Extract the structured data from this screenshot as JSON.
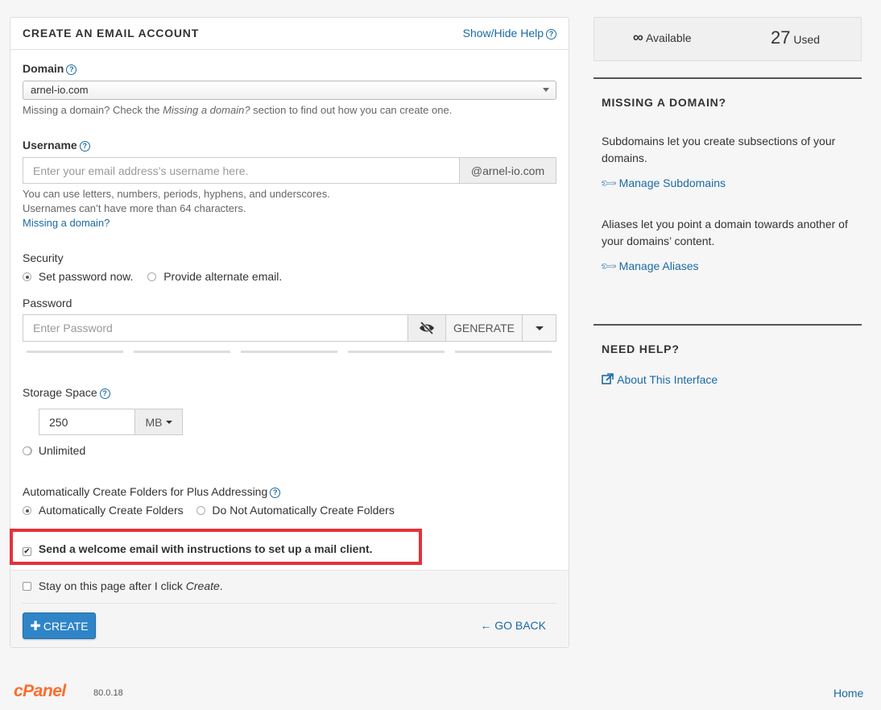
{
  "form": {
    "title": "CREATE AN EMAIL ACCOUNT",
    "help_toggle": "Show/Hide Help",
    "domain_label": "Domain",
    "domain_value": "arnel-io.com",
    "domain_help_prefix": "Missing a domain? Check the ",
    "domain_help_em": "Missing a domain?",
    "domain_help_suffix": " section to find out how you can create one.",
    "username_label": "Username",
    "username_placeholder": "Enter your email address’s username here.",
    "username_suffix": "@arnel-io.com",
    "username_help_1": "You can use letters, numbers, periods, hyphens, and underscores.",
    "username_help_2": "Usernames can’t have more than 64 characters.",
    "missing_domain_link": "Missing a domain?",
    "security_label": "Security",
    "security_options": [
      "Set password now.",
      "Provide alternate email."
    ],
    "security_selected": 0,
    "password_label": "Password",
    "password_placeholder": "Enter Password",
    "generate_label": "GENERATE",
    "storage_label": "Storage Space",
    "storage_value": "250",
    "storage_unit": "MB",
    "storage_unlimited": "Unlimited",
    "plus_label": "Automatically Create Folders for Plus Addressing",
    "plus_options": [
      "Automatically Create Folders",
      "Do Not Automatically Create Folders"
    ],
    "plus_selected": 0,
    "welcome_label": "Send a welcome email with instructions to set up a mail client.",
    "welcome_checked": true,
    "stay_prefix": "Stay on this page after I click ",
    "stay_em": "Create",
    "stay_suffix": ".",
    "stay_checked": false,
    "create_label": "CREATE",
    "go_back_label": "GO BACK"
  },
  "stats": {
    "available_symbol": "∞",
    "available_label": "Available",
    "used_count": "27",
    "used_label": "Used"
  },
  "sidebar": {
    "missing_heading": "MISSING A DOMAIN?",
    "subdomains_text": "Subdomains let you create subsections of your domains.",
    "subdomains_link": "Manage Subdomains",
    "aliases_text": "Aliases let you point a domain towards another of your domains’ content.",
    "aliases_link": "Manage Aliases",
    "need_help_heading": "NEED HELP?",
    "about_link": "About This Interface"
  },
  "footer": {
    "logo": "cPanel",
    "version": "80.0.18",
    "home_link": "Home"
  },
  "colors": {
    "accent": "#2f85c7",
    "link": "#1b6aa5",
    "highlight": "#e53238",
    "logo": "#ff6c2c"
  }
}
